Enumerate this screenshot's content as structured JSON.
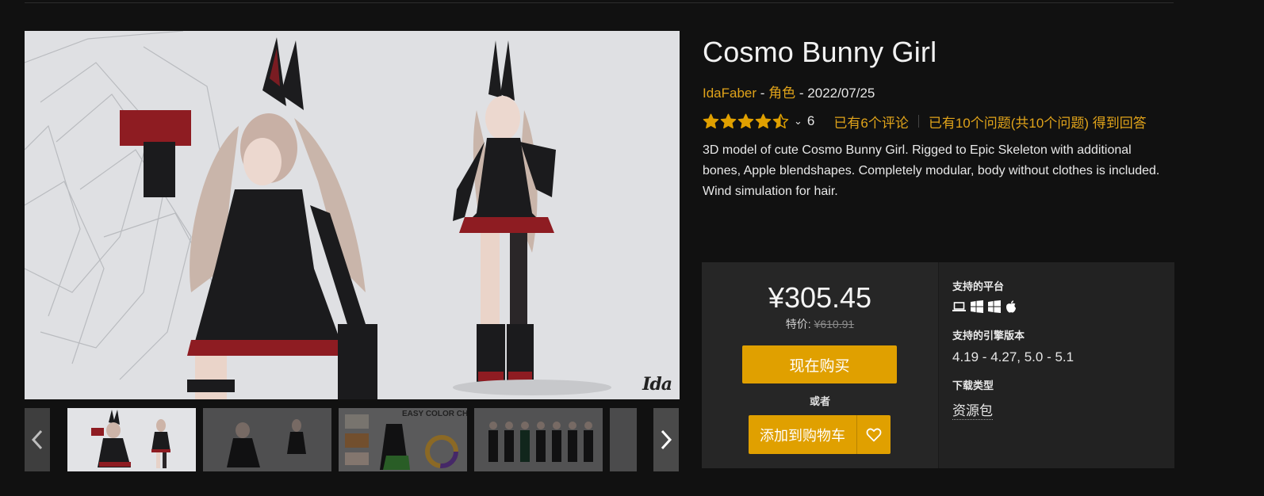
{
  "product": {
    "title": "Cosmo Bunny Girl",
    "author": "IdaFaber",
    "category": "角色",
    "date": "2022/07/25",
    "rating": 4.5,
    "rating_max": 5,
    "rating_count": "6",
    "reviews_link": "已有6个评论",
    "questions_link": "已有10个问题(共10个问题) 得到回答",
    "description": "3D model of cute Cosmo Bunny Girl. Rigged to Epic Skeleton with additional bones, Apple blendshapes. Completely modular, body without clothes is included. Wind simulation for hair."
  },
  "gallery": {
    "hero_icon": "character-render-image",
    "watermark": "Ida",
    "thumbnails": [
      {
        "name": "thumbnail-1",
        "active": true
      },
      {
        "name": "thumbnail-2",
        "active": false
      },
      {
        "name": "thumbnail-3",
        "active": false,
        "caption": "EASY COLOR CHANGE"
      },
      {
        "name": "thumbnail-4",
        "active": false
      },
      {
        "name": "thumbnail-5",
        "active": false
      }
    ],
    "prev_icon": "chevron-left-icon",
    "next_icon": "chevron-right-icon"
  },
  "purchase": {
    "price": "¥305.45",
    "original_label": "特价:",
    "original_price": "¥610.91",
    "buy_now_label": "现在购买",
    "or_label": "或者",
    "add_to_cart_label": "添加到购物车",
    "wishlist_icon": "heart-icon"
  },
  "specs": {
    "platforms_label": "支持的平台",
    "platform_icons": [
      "laptop-icon",
      "windows-icon",
      "windows-icon",
      "apple-icon"
    ],
    "engine_label": "支持的引擎版本",
    "engine_versions": "4.19 - 4.27, 5.0 - 5.1",
    "download_label": "下载类型",
    "download_type": "资源包"
  },
  "colors": {
    "accent": "#e0a000",
    "link": "#e0a31a",
    "background": "#111111",
    "panel": "#262626"
  }
}
